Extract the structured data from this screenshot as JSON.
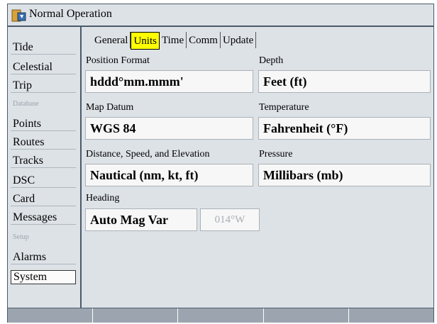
{
  "window": {
    "title": "Normal Operation",
    "icon": "app-icon"
  },
  "sidebar": {
    "items": [
      {
        "label": "Tide",
        "type": "button"
      },
      {
        "label": "Celestial",
        "type": "button"
      },
      {
        "label": "Trip",
        "type": "button"
      },
      {
        "label": "Database",
        "type": "section"
      },
      {
        "label": "Points",
        "type": "button"
      },
      {
        "label": "Routes",
        "type": "button"
      },
      {
        "label": "Tracks",
        "type": "button"
      },
      {
        "label": "DSC",
        "type": "button"
      },
      {
        "label": "Card",
        "type": "button"
      },
      {
        "label": "Messages",
        "type": "button"
      },
      {
        "label": "Setup",
        "type": "section"
      },
      {
        "label": "Alarms",
        "type": "button"
      },
      {
        "label": "System",
        "type": "button",
        "selected": true
      }
    ]
  },
  "tabs": [
    {
      "label": "General",
      "active": false
    },
    {
      "label": "Units",
      "active": true
    },
    {
      "label": "Time",
      "active": false
    },
    {
      "label": "Comm",
      "active": false
    },
    {
      "label": "Update",
      "active": false
    }
  ],
  "fields": {
    "position_format": {
      "label": "Position Format",
      "value": "hddd°mm.mmm'"
    },
    "depth": {
      "label": "Depth",
      "value": "Feet (ft)"
    },
    "map_datum": {
      "label": "Map Datum",
      "value": "WGS 84"
    },
    "temperature": {
      "label": "Temperature",
      "value": "Fahrenheit (°F)"
    },
    "distance": {
      "label": "Distance, Speed, and Elevation",
      "value": "Nautical (nm, kt, ft)"
    },
    "pressure": {
      "label": "Pressure",
      "value": "Millibars (mb)"
    },
    "heading": {
      "label": "Heading",
      "value": "Auto Mag Var",
      "variation": "014°W"
    }
  },
  "colors": {
    "active_tab": "#ffff00",
    "frame": "#4a5a6b",
    "panel": "#dde2e7"
  }
}
